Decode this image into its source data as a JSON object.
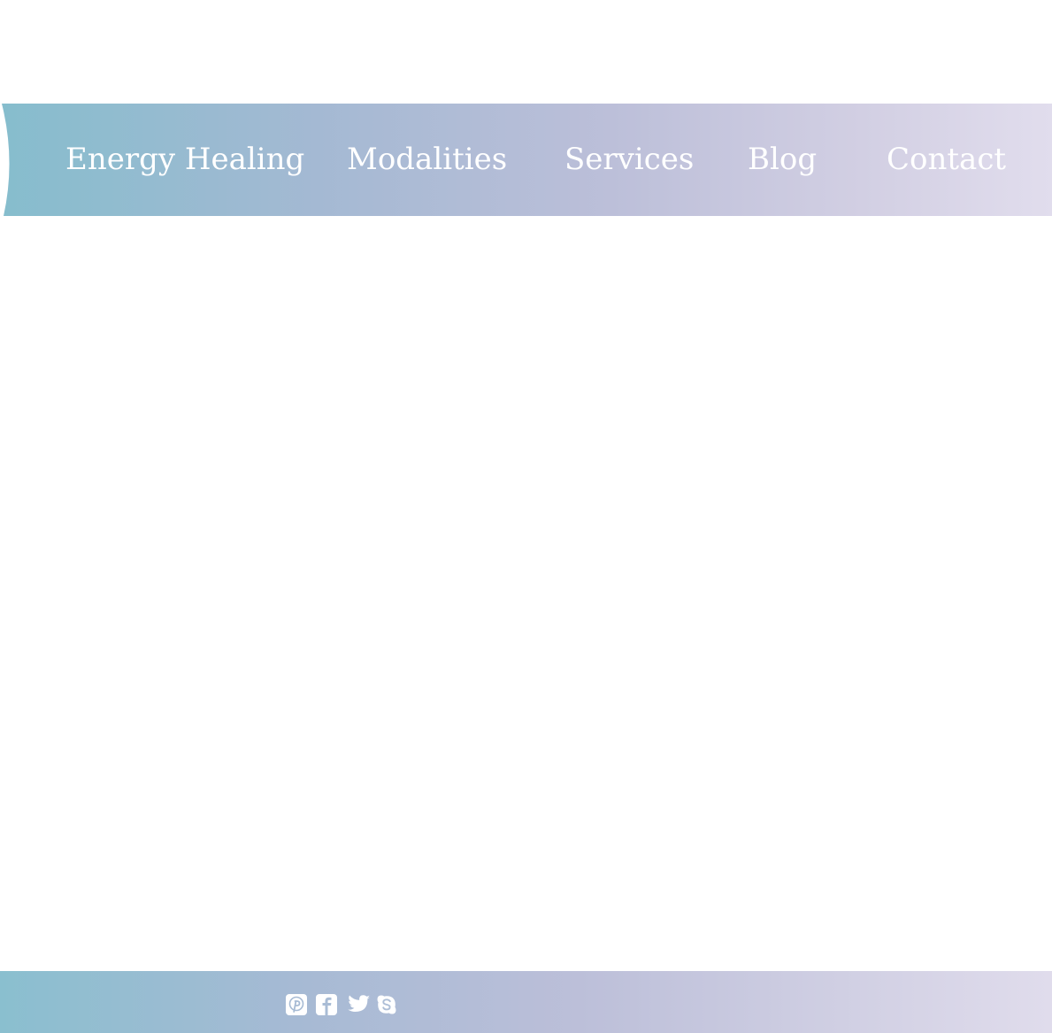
{
  "nav": {
    "items": [
      {
        "label": "Energy Healing"
      },
      {
        "label": "Modalities"
      },
      {
        "label": "Services"
      },
      {
        "label": "Blog"
      },
      {
        "label": "Contact"
      }
    ]
  },
  "footer": {
    "social": [
      {
        "icon": "pinterest-icon"
      },
      {
        "icon": "facebook-icon"
      },
      {
        "icon": "twitter-icon"
      },
      {
        "icon": "skype-icon"
      }
    ]
  },
  "colors": {
    "gradient_start": "#8abfcf",
    "gradient_end": "#e0dcec",
    "text": "#ffffff",
    "background": "#ffffff"
  }
}
